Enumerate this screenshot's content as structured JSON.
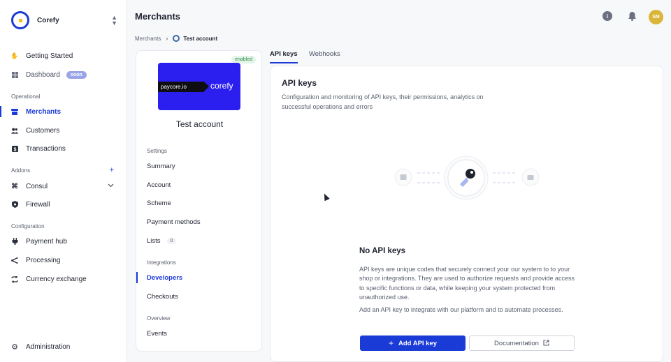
{
  "brand": {
    "name": "Corefy"
  },
  "sidebar": {
    "items": [
      {
        "label": "Getting Started"
      },
      {
        "label": "Dashboard",
        "badge": "soon"
      },
      {
        "label": "Merchants"
      },
      {
        "label": "Customers"
      },
      {
        "label": "Transactions"
      },
      {
        "label": "Consul"
      },
      {
        "label": "Firewall"
      },
      {
        "label": "Payment hub"
      },
      {
        "label": "Processing"
      },
      {
        "label": "Currency exchange"
      },
      {
        "label": "Administration"
      }
    ],
    "sections": {
      "operational": "Operational",
      "addons": "Addons",
      "configuration": "Configuration"
    },
    "addons_plus": "+"
  },
  "header": {
    "title": "Merchants",
    "avatar_initials": "SM",
    "info_glyph": "i"
  },
  "breadcrumb": {
    "root": "Merchants",
    "current": "Test account"
  },
  "merchant": {
    "status": "enabled",
    "name": "Test account",
    "logo_text_left": "paycore.io",
    "logo_text_right": "corefy"
  },
  "card_menu": {
    "settings_label": "Settings",
    "settings": [
      "Summary",
      "Account",
      "Scheme",
      "Payment methods",
      "Lists"
    ],
    "lists_count": "0",
    "integrations_label": "Integrations",
    "integrations": [
      "Developers",
      "Checkouts"
    ],
    "overview_label": "Overview",
    "overview": [
      "Events"
    ]
  },
  "tabs": [
    "API keys",
    "Webhooks"
  ],
  "panel": {
    "title": "API keys",
    "description": "Configuration and monitoring of API keys, their permissions, analytics on successful operations and errors",
    "empty_title": "No API keys",
    "empty_p1": "API keys are unique codes that securely connect your our system to to your shop or integrations. They are used to authorize requests and provide access to specific functions or data, while keeping your system protected from unauthorized use.",
    "empty_p2": "Add an API key to integrate with our platform and to automate processes.",
    "add_button": "Add API key",
    "docs_button": "Documentation"
  },
  "colors": {
    "accent": "#1b3bd6",
    "enabled_bg": "#e3f5e8",
    "enabled_text": "#2d8a48",
    "avatar": "#d9b63a",
    "logo_bg": "#2b1ff0"
  },
  "icons": {
    "getting_started": "hand-wave-icon",
    "dashboard": "dashboard-icon",
    "merchants": "store-icon",
    "customers": "users-icon",
    "transactions": "dollar-icon",
    "consul": "command-icon",
    "firewall": "shield-icon",
    "payment_hub": "plug-icon",
    "processing": "route-icon",
    "currency_exchange": "exchange-icon",
    "administration": "gear-icon"
  }
}
